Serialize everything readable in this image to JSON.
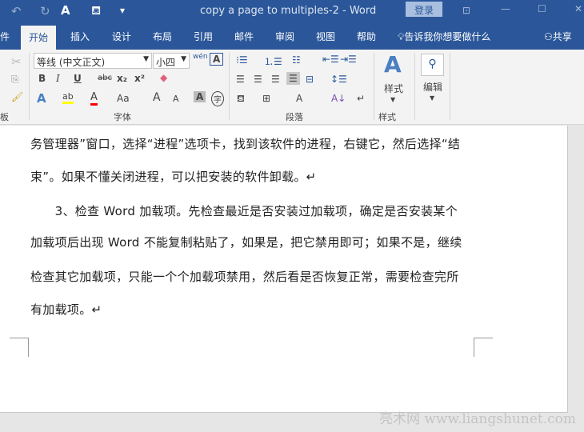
{
  "titlebar": {
    "title": "copy a page to multiples-2  -  Word",
    "login": "登录",
    "undo": "↶",
    "redo": "↻",
    "font_color_qat": "A",
    "fill_qat": "⛾",
    "customize": "▾",
    "ribbon_display": "⊡",
    "minimize": "—",
    "maximize": "☐",
    "close": "✕"
  },
  "tabs": [
    {
      "label": "件"
    },
    {
      "label": "开始"
    },
    {
      "label": "插入"
    },
    {
      "label": "设计"
    },
    {
      "label": "布局"
    },
    {
      "label": "引用"
    },
    {
      "label": "邮件"
    },
    {
      "label": "审阅"
    },
    {
      "label": "视图"
    },
    {
      "label": "帮助"
    }
  ],
  "tell_me": "告诉我你想要做什么",
  "share": "共享",
  "ribbon": {
    "clipboard_group": "板",
    "font_name": "等线 (中文正文)",
    "font_size": "小四",
    "font_group": "字体",
    "paragraph_group": "段落",
    "styles_group": "样式",
    "styles_button": "样式",
    "edit_button": "编辑",
    "bold": "B",
    "italic": "I",
    "underline": "U",
    "strike": "abc",
    "sub": "x₂",
    "sup": "x²",
    "phonetic": "wén",
    "grow": "A",
    "shrink": "A",
    "case": "Aa",
    "char_shade": "A",
    "enclose": "字"
  },
  "colors": {
    "accent": "#2b579a",
    "highlight": "#ffff00",
    "font_color": "#ff0000"
  },
  "document": {
    "lines": [
      "务管理器”窗口，选择“进程”选项卡，找到该软件的进程，右键它，然后选择“结",
      "束”。如果不懂关闭进程，可以把安装的软件卸载。↵",
      "　　3、检查 Word 加载项。先检查最近是否安装过加载项，确定是否安装某个",
      "加载项后出现 Word 不能复制粘贴了，如果是，把它禁用即可；如果不是，继续",
      "检查其它加载项，只能一个个加载项禁用，然后看是否恢复正常，需要检查完所",
      "有加载项。↵"
    ]
  },
  "watermark": "亮术网 www.liangshunet.com"
}
